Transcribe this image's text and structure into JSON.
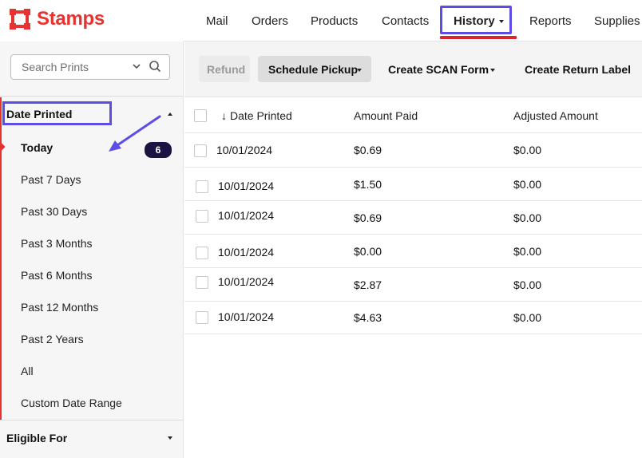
{
  "brand": {
    "name": "Stamps",
    "color": "#e63330"
  },
  "topnav": {
    "tabs": [
      {
        "label": "Mail"
      },
      {
        "label": "Orders"
      },
      {
        "label": "Products"
      },
      {
        "label": "Contacts"
      },
      {
        "label": "History",
        "active": true
      },
      {
        "label": "Reports"
      },
      {
        "label": "Supplies"
      }
    ]
  },
  "sidebar": {
    "search_placeholder": "Search Prints",
    "date_printed": {
      "title": "Date Printed",
      "items": [
        {
          "label": "Today",
          "active": true,
          "count": "6"
        },
        {
          "label": "Past 7 Days"
        },
        {
          "label": "Past 30 Days"
        },
        {
          "label": "Past 3 Months"
        },
        {
          "label": "Past 6 Months"
        },
        {
          "label": "Past 12 Months"
        },
        {
          "label": "Past 2 Years"
        },
        {
          "label": "All"
        },
        {
          "label": "Custom Date Range"
        }
      ]
    },
    "eligible_for": {
      "title": "Eligible For"
    }
  },
  "toolbar": {
    "refund": "Refund",
    "schedule_pickup": "Schedule Pickup",
    "create_scan_form": "Create SCAN Form",
    "create_return_label": "Create Return Label"
  },
  "table": {
    "columns": [
      "Date Printed",
      "Amount Paid",
      "Adjusted Amount"
    ],
    "sort_indicator": "↓",
    "rows": [
      {
        "date": "10/01/2024",
        "paid": "$0.69",
        "adjusted": "$0.00"
      },
      {
        "date": "10/01/2024",
        "paid": "$1.50",
        "adjusted": "$0.00"
      },
      {
        "date": "10/01/2024",
        "paid": "$0.69",
        "adjusted": "$0.00"
      },
      {
        "date": "10/01/2024",
        "paid": "$0.00",
        "adjusted": "$0.00"
      },
      {
        "date": "10/01/2024",
        "paid": "$2.87",
        "adjusted": "$0.00"
      },
      {
        "date": "10/01/2024",
        "paid": "$4.63",
        "adjusted": "$0.00"
      }
    ]
  },
  "colors": {
    "highlight": "#5b4de6",
    "accent": "#e63330",
    "badge": "#1b1442"
  }
}
